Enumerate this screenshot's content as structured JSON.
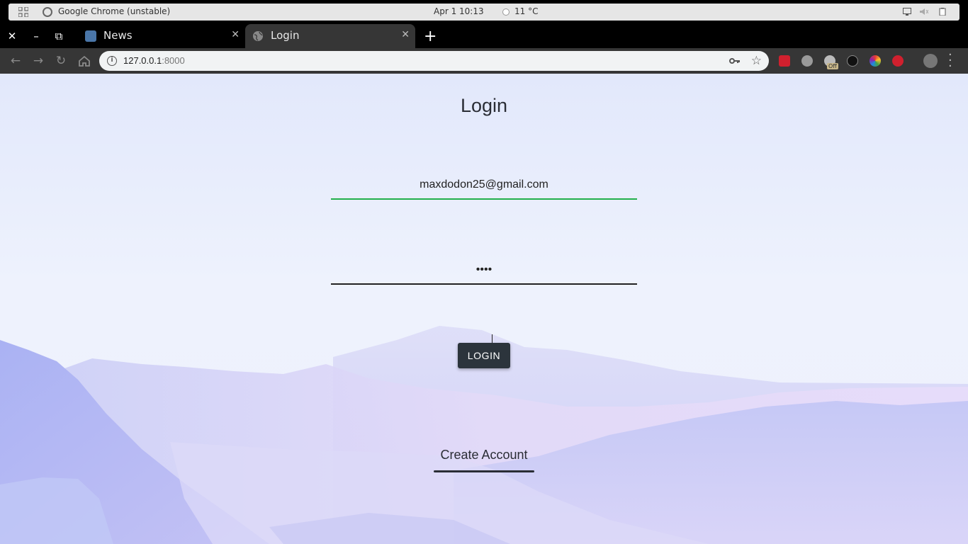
{
  "os_bar": {
    "app_title": "Google Chrome (unstable)",
    "clock": "Apr 1  10:13",
    "weather": "11 °C"
  },
  "browser": {
    "window_controls": {
      "close": "✕",
      "minimize": "–",
      "maximize": "⧉"
    },
    "tabs": [
      {
        "label": "News",
        "favicon": "vk-icon",
        "favicon_color": "#4a76a8",
        "active": false
      },
      {
        "label": "Login",
        "favicon": "globe-icon",
        "favicon_color": "#8a8a8a",
        "active": true
      }
    ],
    "new_tab": "+",
    "url_host": "127.0.0.1",
    "url_port": ":8000",
    "extension_badge": "Off",
    "extensions": [
      "pocket-cast-icon",
      "m-icon",
      "dog-icon",
      "gnome-icon",
      "color-wheel-icon",
      "adblock-plus-icon",
      "profile-avatar-icon"
    ]
  },
  "page": {
    "title": "Login",
    "email_value": "maxdodon25@gmail.com",
    "password_value": "••••",
    "login_button": "LOGIN",
    "create_account": "Create Account"
  },
  "colors": {
    "accent_green": "#22b04b",
    "button_dark": "#2c343c",
    "page_bg_top": "#e2e8fb",
    "mountain_blue": "#b4bcf5",
    "mountain_lavender": "#d8d0f6"
  }
}
